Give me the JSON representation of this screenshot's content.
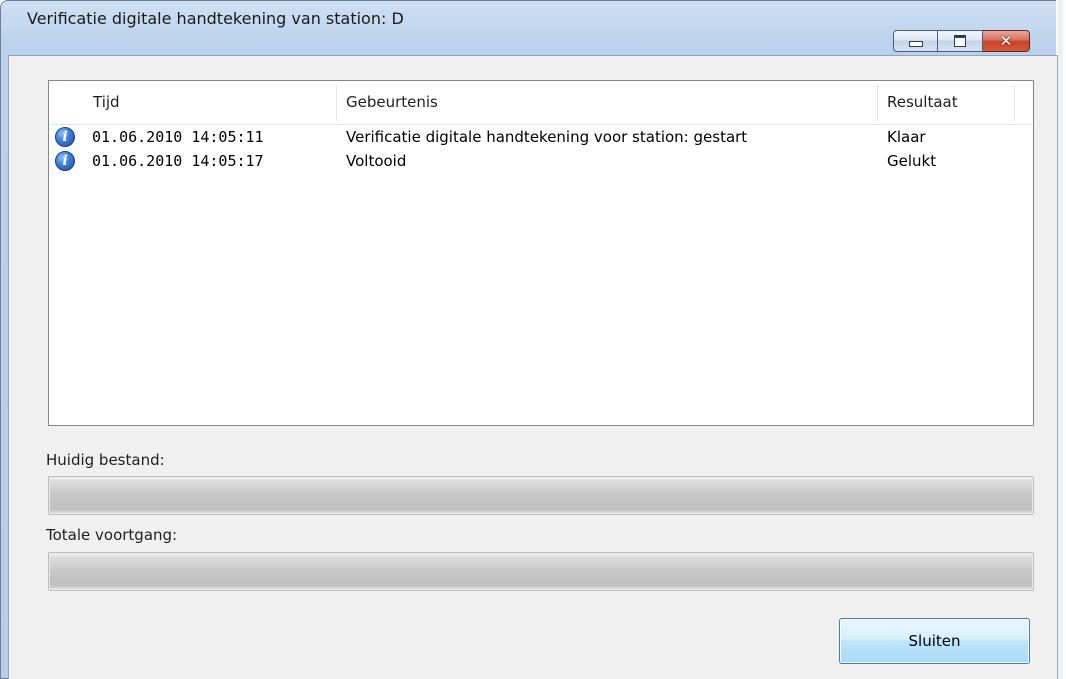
{
  "window": {
    "title": "Verificatie digitale handtekening van station: D",
    "minimize_glyph": "",
    "maximize_glyph": "",
    "close_glyph": "✕"
  },
  "log": {
    "columns": {
      "time": "Tijd",
      "event": "Gebeurtenis",
      "result": "Resultaat"
    },
    "rows": [
      {
        "icon": "info-icon",
        "time": "01.06.2010 14:05:11",
        "event": "Verificatie digitale handtekening voor station: gestart",
        "result": "Klaar"
      },
      {
        "icon": "info-icon",
        "time": "01.06.2010 14:05:17",
        "event": "Voltooid",
        "result": "Gelukt"
      }
    ]
  },
  "progress": {
    "current_file_label": "Huidig bestand:",
    "current_file_value": 0,
    "total_label": "Totale voortgang:",
    "total_value": 0
  },
  "buttons": {
    "close_label": "Sluiten"
  },
  "colors": {
    "progress_fill": "#06b025",
    "button_border": "#3c7fb1"
  }
}
